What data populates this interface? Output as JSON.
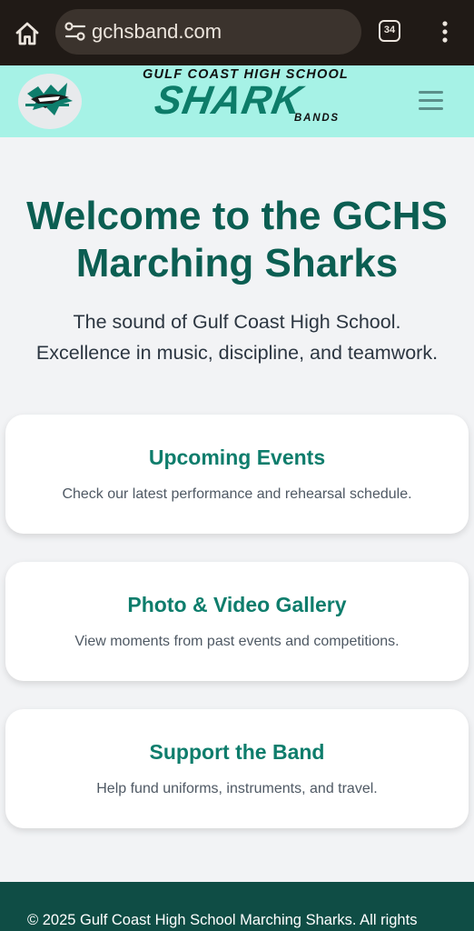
{
  "browser": {
    "url": "gchsband.com",
    "tab_count": "34",
    "icons": [
      "home-icon",
      "site-settings-icon",
      "tabs-icon",
      "more-vert-icon"
    ]
  },
  "header": {
    "logo_icon": "shark-logo",
    "brand_school": "GULF COAST HIGH SCHOOL",
    "brand_name": "SHARK",
    "brand_sub": "BANDS",
    "menu_icon": "hamburger-icon"
  },
  "hero": {
    "title_line1": "Welcome to the GCHS",
    "title_line2": "Marching Sharks",
    "subtitle_line1": "The sound of Gulf Coast High School.",
    "subtitle_line2": "Excellence in music, discipline, and teamwork."
  },
  "cards": [
    {
      "title": "Upcoming Events",
      "description": "Check our latest performance and rehearsal schedule."
    },
    {
      "title": "Photo & Video Gallery",
      "description": "View moments from past events and competitions."
    },
    {
      "title": "Support the Band",
      "description": "Help fund uniforms, instruments, and travel."
    }
  ],
  "footer": {
    "copyright": "© 2025 Gulf Coast High School Marching Sharks. All rights"
  },
  "colors": {
    "browser_bar": "#201a16",
    "header_bg": "#a6f2e6",
    "accent": "#0b5e52",
    "card_title": "#0e7d6c",
    "footer_bg": "#0f4d45",
    "page_bg": "#f2f3f5"
  }
}
